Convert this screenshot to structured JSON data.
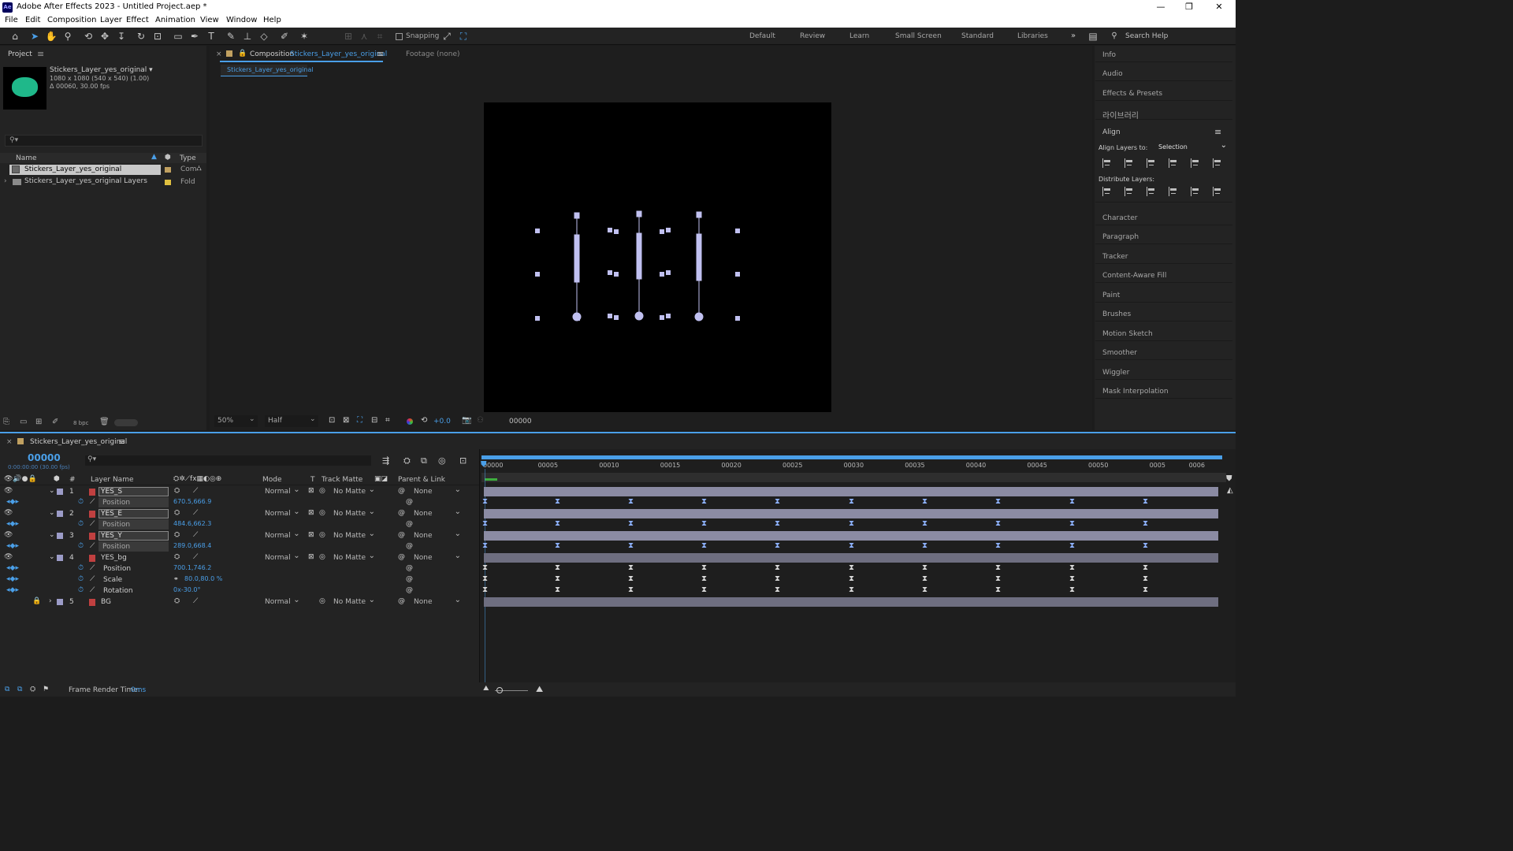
{
  "window": {
    "title": "Adobe After Effects 2023 - Untitled Project.aep *",
    "logo": "Ae"
  },
  "menu": [
    "File",
    "Edit",
    "Composition",
    "Layer",
    "Effect",
    "Animation",
    "View",
    "Window",
    "Help"
  ],
  "toolbar": {
    "snapping": "Snapping",
    "workspaces": [
      "Default",
      "Review",
      "Learn",
      "Small Screen",
      "Standard",
      "Libraries"
    ],
    "search_placeholder": "Search Help"
  },
  "project": {
    "tab": "Project",
    "item_name": "Stickers_Layer_yes_original ▾",
    "item_size": "1080 x 1080  (540 x 540) (1.00)",
    "item_duration": "Δ 00060, 30.00 fps",
    "search_placeholder": "⚲▾",
    "col_name": "Name",
    "col_type": "Type",
    "rows": [
      {
        "name": "Stickers_Layer_yes_original",
        "type": "Com"
      },
      {
        "name": "Stickers_Layer_yes_original Layers",
        "type": "Fold"
      }
    ],
    "bpc": "8 bpc"
  },
  "comp": {
    "tab_label": "Composition",
    "tab_name": "Stickers_Layer_yes_original",
    "footage": "Footage (none)",
    "subtab": "Stickers_Layer_yes_original",
    "zoom": "50%",
    "resolution": "Half",
    "exposure": "+0.0",
    "timecode": "00000"
  },
  "right": {
    "panels_top": [
      "Info",
      "Audio",
      "Effects & Presets",
      "라이브러리"
    ],
    "align_title": "Align",
    "align_layers_to": "Align Layers to:",
    "align_selection": "Selection",
    "distribute": "Distribute Layers:",
    "panels_bottom": [
      "Character",
      "Paragraph",
      "Tracker",
      "Content-Aware Fill",
      "Paint",
      "Brushes",
      "Motion Sketch",
      "Smoother",
      "Wiggler",
      "Mask Interpolation"
    ]
  },
  "timeline": {
    "tab": "Stickers_Layer_yes_original",
    "current_time": "00000",
    "time_sub": "0:00:00:00 (30.00 fps)",
    "headers": {
      "layer_name": "Layer Name",
      "mode": "Mode",
      "t": "T",
      "track_matte": "Track Matte",
      "parent": "Parent & Link"
    },
    "ruler": [
      "00000",
      "00005",
      "00010",
      "00015",
      "00020",
      "00025",
      "00030",
      "00035",
      "00040",
      "00045",
      "00050",
      "0005",
      "0006"
    ],
    "layers": [
      {
        "num": "1",
        "name": "YES_S",
        "mode": "Normal",
        "matte": "No Matte",
        "parent": "None",
        "prop": "Position",
        "value": "670.5,666.9"
      },
      {
        "num": "2",
        "name": "YES_E",
        "mode": "Normal",
        "matte": "No Matte",
        "parent": "None",
        "prop": "Position",
        "value": "484.6,662.3"
      },
      {
        "num": "3",
        "name": "YES_Y",
        "mode": "Normal",
        "matte": "No Matte",
        "parent": "None",
        "prop": "Position",
        "value": "289.0,668.4"
      },
      {
        "num": "4",
        "name": "YES_bg",
        "mode": "Normal",
        "matte": "No Matte",
        "parent": "None"
      },
      {
        "num": "5",
        "name": "BG",
        "mode": "Normal",
        "matte": "No Matte",
        "parent": "None"
      }
    ],
    "bg_props": [
      {
        "name": "Position",
        "value": "700.1,746.2"
      },
      {
        "name": "Scale",
        "value": "80.0,80.0 %"
      },
      {
        "name": "Rotation",
        "value": "0x-30.0°"
      }
    ],
    "render_label": "Frame Render Time:",
    "render_value": "0ms"
  },
  "colors": {
    "accent": "#4a9fe8",
    "track": "#8b8ba3",
    "label_yellow": "#e0c040"
  }
}
